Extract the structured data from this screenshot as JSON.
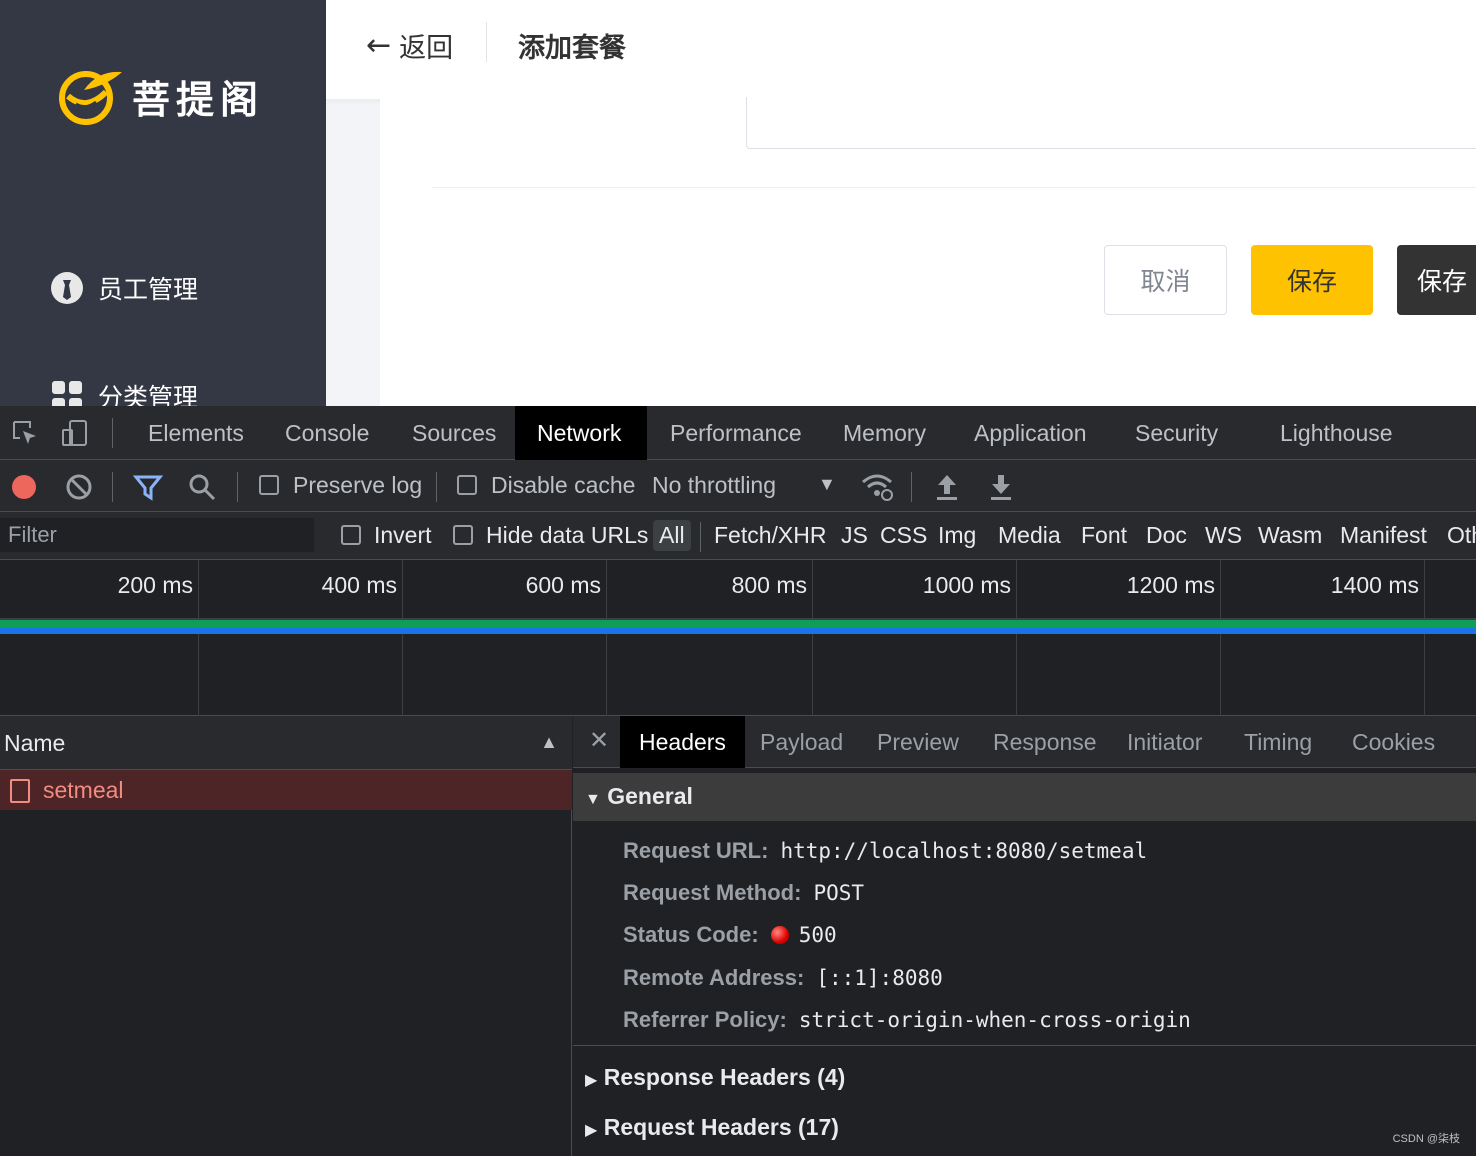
{
  "app": {
    "logo_text": "菩提阁",
    "sidebar": [
      {
        "label": "员工管理",
        "icon": "employee-icon"
      },
      {
        "label": "分类管理",
        "icon": "category-icon"
      }
    ],
    "back_label": "返回",
    "page_title": "添加套餐",
    "buttons": {
      "cancel": "取消",
      "save": "保存",
      "save_continue": "保存"
    }
  },
  "devtools": {
    "tabs": [
      "Elements",
      "Console",
      "Sources",
      "Network",
      "Performance",
      "Memory",
      "Application",
      "Security",
      "Lighthouse"
    ],
    "active_tab": "Network",
    "toolbar": {
      "preserve_log": "Preserve log",
      "disable_cache": "Disable cache",
      "throttling": "No throttling"
    },
    "filter": {
      "placeholder": "Filter",
      "invert": "Invert",
      "hide_data_urls": "Hide data URLs",
      "types": [
        "All",
        "Fetch/XHR",
        "JS",
        "CSS",
        "Img",
        "Media",
        "Font",
        "Doc",
        "WS",
        "Wasm",
        "Manifest",
        "Oth"
      ],
      "active_type": "All"
    },
    "timeline_ticks": [
      "200 ms",
      "400 ms",
      "600 ms",
      "800 ms",
      "1000 ms",
      "1200 ms",
      "1400 ms"
    ],
    "colors": {
      "green": "#0f9d58",
      "blue": "#1a73e8",
      "error": "#f28b82"
    },
    "requests": {
      "column": "Name",
      "rows": [
        {
          "name": "setmeal",
          "status": "error"
        }
      ]
    },
    "detail": {
      "tabs": [
        "Headers",
        "Payload",
        "Preview",
        "Response",
        "Initiator",
        "Timing",
        "Cookies"
      ],
      "active_tab": "Headers",
      "general_title": "General",
      "general": [
        {
          "key": "Request URL:",
          "value": "http://localhost:8080/setmeal"
        },
        {
          "key": "Request Method:",
          "value": "POST"
        },
        {
          "key": "Status Code:",
          "value": "500"
        },
        {
          "key": "Remote Address:",
          "value": "[::1]:8080"
        },
        {
          "key": "Referrer Policy:",
          "value": "strict-origin-when-cross-origin"
        }
      ],
      "response_headers": "Response Headers (4)",
      "request_headers": "Request Headers (17)"
    },
    "watermark": "CSDN @柒枝"
  }
}
